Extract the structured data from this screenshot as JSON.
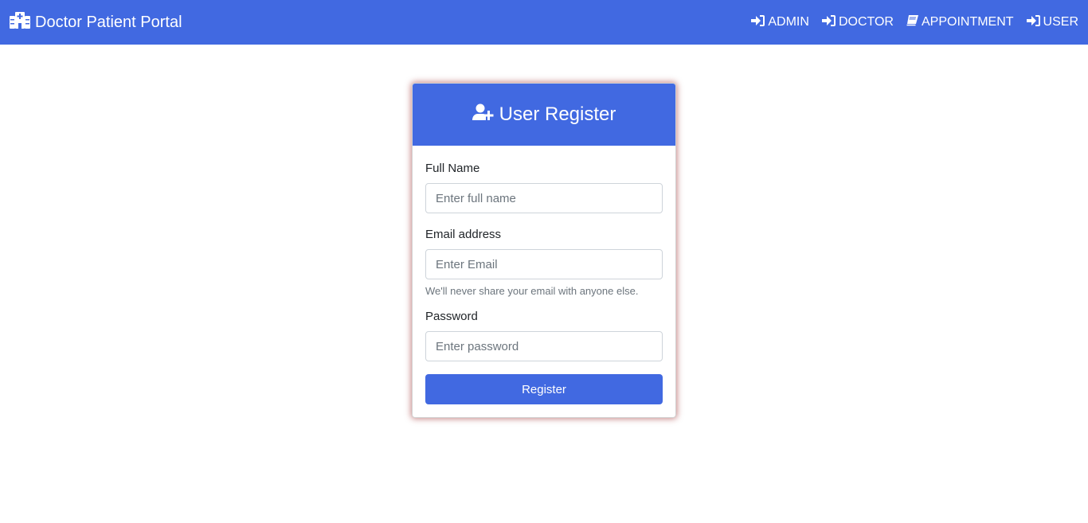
{
  "navbar": {
    "brand": "Doctor Patient Portal",
    "brand_icon": "hospital-icon",
    "links": [
      {
        "label": "ADMIN",
        "icon": "sign-in-icon"
      },
      {
        "label": "DOCTOR",
        "icon": "sign-in-icon"
      },
      {
        "label": "APPOINTMENT",
        "icon": "book-icon"
      },
      {
        "label": "USER",
        "icon": "sign-in-icon"
      }
    ]
  },
  "form": {
    "title": "User Register",
    "title_icon": "user-plus-icon",
    "fields": [
      {
        "label": "Full Name",
        "placeholder": "Enter full name",
        "value": ""
      },
      {
        "label": "Email address",
        "placeholder": "Enter Email",
        "value": "",
        "help": "We'll never share your email with anyone else."
      },
      {
        "label": "Password",
        "placeholder": "Enter password",
        "value": ""
      }
    ],
    "submit_label": "Register"
  },
  "colors": {
    "primary": "#4169e1",
    "card_shadow": "#961e1e"
  }
}
